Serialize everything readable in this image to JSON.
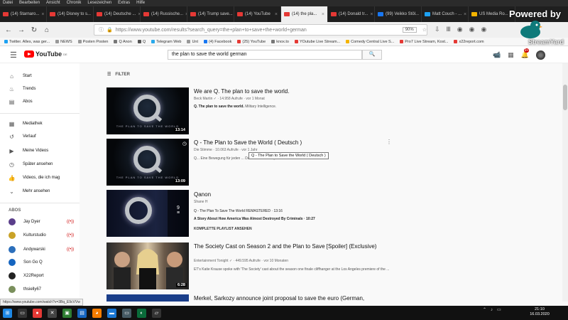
{
  "menubar": [
    "Datei",
    "Bearbeiten",
    "Ansicht",
    "Chronik",
    "Lesezeichen",
    "Extras",
    "Hilfe"
  ],
  "tabs": [
    {
      "label": "(14) Starnaro...",
      "color": "#e53935",
      "active": false
    },
    {
      "label": "(14) Disney to s...",
      "color": "#e53935",
      "active": false
    },
    {
      "label": "(14) Deutsche ...",
      "color": "#e53935",
      "active": false
    },
    {
      "label": "(14) Russische...",
      "color": "#e53935",
      "active": false
    },
    {
      "label": "(14) Trump save...",
      "color": "#e53935",
      "active": false
    },
    {
      "label": "(14) YouTube",
      "color": "#e53935",
      "active": false
    },
    {
      "label": "(14) the pla...",
      "color": "#e53935",
      "active": true
    },
    {
      "label": "(14) Donald tr...",
      "color": "#e53935",
      "active": false
    },
    {
      "label": "(99) Veikko Stöl...",
      "color": "#1877f2",
      "active": false
    },
    {
      "label": "Matt Couch - ...",
      "color": "#1da1f2",
      "active": false
    },
    {
      "label": "US Media Ro...",
      "color": "#f4b400",
      "active": false
    }
  ],
  "nav": {
    "url": "https://www.youtube.com/results?search_query=the+plan+to+save+the+world+german",
    "zoom": "90%"
  },
  "bookmarks": [
    "Twitter. Alles, was ger...",
    "NEWS",
    "Posten Posten",
    "Q Anon",
    "Q",
    "Telegram Web",
    "Unt",
    "(4) Facebook",
    "(25) YouTube",
    "knox.to",
    "YOutube Live Stream...",
    "Comedy Central Live S...",
    "Pro7 Live Stream, Kost...",
    "x22report.com"
  ],
  "overlay": {
    "brand": "Powered by",
    "watermark": "StreamYard"
  },
  "yt": {
    "logo": "YouTube",
    "logo_suffix": "DE",
    "search_query": "the plan to save the world german",
    "notif_count": "9+"
  },
  "sidebar": {
    "items": [
      {
        "label": "Start",
        "icon": "home-icon",
        "glyph": "⌂"
      },
      {
        "label": "Trends",
        "icon": "flame-icon",
        "glyph": "♨"
      },
      {
        "label": "Abos",
        "icon": "subscriptions-icon",
        "glyph": "▤"
      },
      {
        "label": "Mediathek",
        "icon": "library-icon",
        "glyph": "▦"
      },
      {
        "label": "Verlauf",
        "icon": "history-icon",
        "glyph": "↺"
      },
      {
        "label": "Meine Videos",
        "icon": "my-videos-icon",
        "glyph": "▶"
      },
      {
        "label": "Später ansehen",
        "icon": "clock-icon",
        "glyph": "◷"
      },
      {
        "label": "Videos, die ich mag",
        "icon": "thumbs-up-icon",
        "glyph": "👍"
      },
      {
        "label": "Mehr ansehen",
        "icon": "chevron-down-icon",
        "glyph": "⌄"
      }
    ],
    "abos_title": "ABOS",
    "subscriptions": [
      {
        "label": "Jay Dyer",
        "color": "#5a3e8a",
        "live": true
      },
      {
        "label": "Kulturstudio",
        "color": "#c9a227",
        "live": true
      },
      {
        "label": "Andywarski",
        "color": "#2c6fbb",
        "live": true
      },
      {
        "label": "Son Go Q",
        "color": "#1565c0",
        "live": false
      },
      {
        "label": "X22Report",
        "color": "#222222",
        "live": false
      },
      {
        "label": "thsielly67",
        "color": "#7a8f5c",
        "live": false
      }
    ]
  },
  "main": {
    "filter_label": "FILTER",
    "tooltip": "Q - The Plan to Save the World ( Deutsch )",
    "results": [
      {
        "title": "We are Q. The plan to save the world.",
        "meta": "Beck Martin ✓ · 14.958 Aufrufe · vor 1 Monat",
        "desc_bold": "Q. The plan to save the world.",
        "desc": " Military Intelligence.",
        "duration": "13:14",
        "caption": "THE PLAN TO SAVE THE WORLD"
      },
      {
        "title": "Q - The Plan to Save the World ( Deutsch )",
        "meta": "Die Stimme · 10.063 Aufrufe · vor 1 Jahr",
        "desc_bold": "",
        "desc": "Q... Eine Bewegung für jeden ... Das Video ist komplett in Deutsch...",
        "duration": "13:09",
        "caption": "THE PLAN TO SAVE THE WORLD"
      },
      {
        "title": "Qanon",
        "meta": "Shane H",
        "playlist_count": "9",
        "lines": [
          "Q - The Plan To Save The World REMASTERED · 13:16",
          "A Story About How America Was Almost Destroyed By Criminals · 10:27",
          "KOMPLETTE PLAYLIST ANSEHEN"
        ]
      },
      {
        "title": "The Society Cast on Season 2 and the Plan to Save [Spoiler] (Exclusive)",
        "meta": "Entertainment Tonight ✓ · 449.595 Aufrufe · vor 10 Monaten",
        "desc_bold": "",
        "desc": "ET's Katie Krause spoke with 'The Society' cast about the season one finale cliffhanger at the Los Angeles premiere of the ...",
        "duration": "6:28"
      },
      {
        "title": "Merkel, Sarkozy announce joint proposal to save the euro (German,"
      }
    ]
  },
  "statusbar": "https://www.youtube.com/watch?v=3Bq_E9cVVw",
  "clock": {
    "time": "21:10",
    "date": "16.03.2020"
  }
}
